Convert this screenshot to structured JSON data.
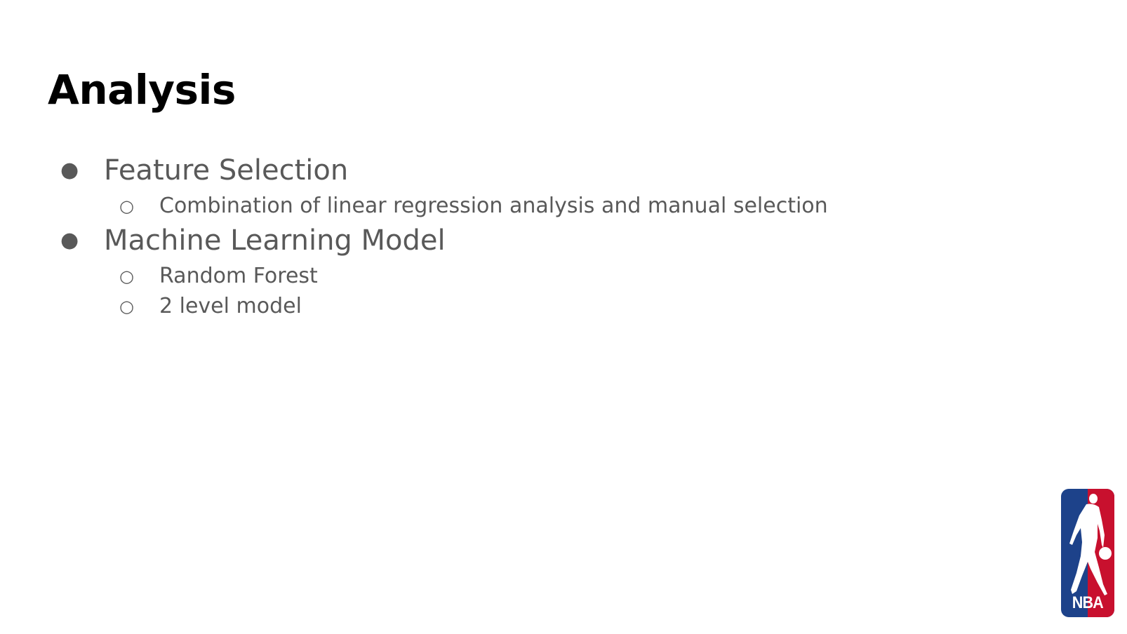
{
  "slide": {
    "title": "Analysis",
    "bullets": [
      {
        "text": "Feature Selection",
        "marker": "●",
        "children": [
          {
            "text": "Combination of linear regression analysis and manual selection",
            "marker": "○"
          }
        ]
      },
      {
        "text": "Machine Learning Model",
        "marker": "●",
        "children": [
          {
            "text": "Random Forest",
            "marker": "○"
          },
          {
            "text": "2 level model",
            "marker": "○"
          }
        ]
      }
    ],
    "logo": {
      "name": "nba-logo",
      "text": "NBA",
      "colors": {
        "blue": "#1d428a",
        "red": "#c8102e",
        "white": "#ffffff"
      }
    }
  },
  "colors": {
    "title": "#000000",
    "body_text": "#595959",
    "background": "#ffffff"
  }
}
